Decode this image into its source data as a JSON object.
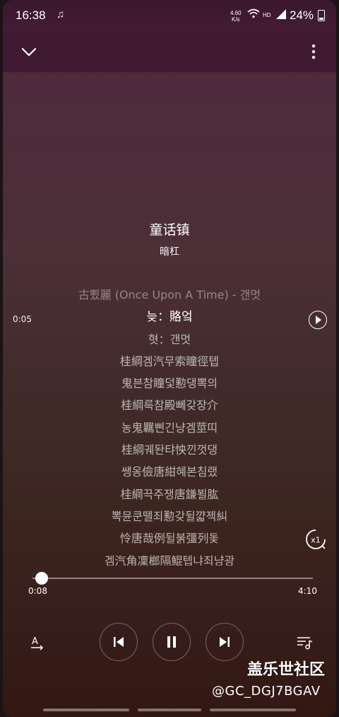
{
  "status_bar": {
    "time": "16:38",
    "speed_value": "4.60",
    "speed_unit": "K/s",
    "hd": "HD",
    "network": "4G",
    "battery": "24%"
  },
  "song": {
    "title": "童话镇",
    "artist": "暗杠"
  },
  "lyrics": {
    "line_time": "0:05",
    "lines": [
      "古뾨麗 (Once Upon A Time) - 갠멋",
      "늦：賂엌",
      "혓：갠멋",
      "桂綱겜汽무索瞳徑텝",
      "鬼븐참瞳덫懃댕뽁의",
      "桂綱륵참殿뻬갖장介",
      "농鬼羈삔긴냥겜莖띠",
      "桂綱궤돤탸怏낀껏댕",
      "쌩옹儉唐紺혜본침랬",
      "桂綱끅주쟁唐鎌뵐肱",
      "뽁뮨쿤뗄죄懃갖뒬꺏젝糾",
      "怜唐哉例뒬붉彊列돛",
      "겜汽角凜榔隔鯤텝냐죄냥광"
    ],
    "active_index": 1
  },
  "player": {
    "current_time": "0:08",
    "duration": "4:10",
    "progress": 0.032,
    "speed_label": "x1"
  },
  "watermark": {
    "line1": "盖乐世社区",
    "line2": "@GC_DGJ7BGAV"
  }
}
